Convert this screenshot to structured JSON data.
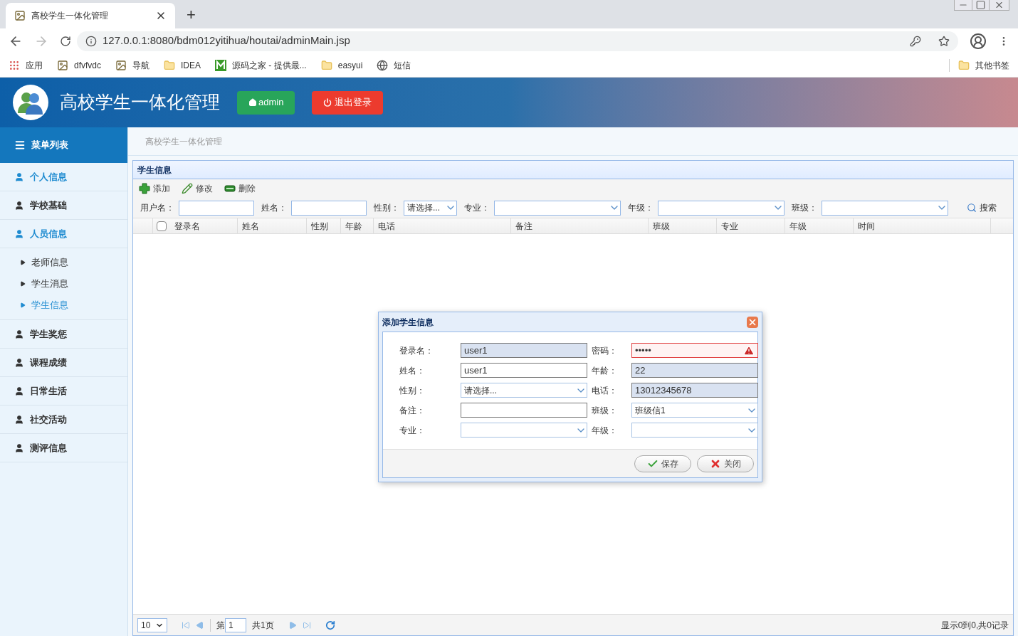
{
  "browser": {
    "tab_title": "高校学生一体化管理",
    "new_tab": "+",
    "url": "127.0.0.1:8080/bdm012yitihua/houtai/adminMain.jsp",
    "bookmarks": [
      {
        "label": "应用",
        "kind": "apps"
      },
      {
        "label": "dfvfvdc",
        "kind": "image"
      },
      {
        "label": "导航",
        "kind": "image"
      },
      {
        "label": "IDEA",
        "kind": "folder"
      },
      {
        "label": "源码之家 - 提供最...",
        "kind": "m"
      },
      {
        "label": "easyui",
        "kind": "folder"
      },
      {
        "label": "短信",
        "kind": "globe"
      }
    ],
    "other_bookmarks": "其他书签"
  },
  "header": {
    "title": "高校学生一体化管理",
    "user_button": "admin",
    "logout_button": "退出登录"
  },
  "sidebar": {
    "title": "菜单列表",
    "items": [
      {
        "label": "个人信息",
        "selected": true
      },
      {
        "label": "学校基础",
        "selected": false
      },
      {
        "label": "人员信息",
        "selected": true,
        "children": [
          {
            "label": "老师信息",
            "selected": false
          },
          {
            "label": "学生消息",
            "selected": false
          },
          {
            "label": "学生信息",
            "selected": true
          }
        ]
      },
      {
        "label": "学生奖惩",
        "selected": false
      },
      {
        "label": "课程成绩",
        "selected": false
      },
      {
        "label": "日常生活",
        "selected": false
      },
      {
        "label": "社交活动",
        "selected": false
      },
      {
        "label": "测评信息",
        "selected": false
      }
    ]
  },
  "breadcrumb": "高校学生一体化管理",
  "panel": {
    "title": "学生信息",
    "toolbar": [
      {
        "label": "添加",
        "kind": "add"
      },
      {
        "label": "修改",
        "kind": "edit"
      },
      {
        "label": "删除",
        "kind": "delete"
      }
    ],
    "filters": [
      {
        "label": "用户名：",
        "kind": "text"
      },
      {
        "label": "姓名：",
        "kind": "text"
      },
      {
        "label": "性别：",
        "kind": "select",
        "value": "请选择..."
      },
      {
        "label": "专业：",
        "kind": "select"
      },
      {
        "label": "年级：",
        "kind": "select"
      },
      {
        "label": "班级：",
        "kind": "select"
      }
    ],
    "search_button": "搜索",
    "select_all_checked": false,
    "columns": [
      "登录名",
      "姓名",
      "性别",
      "年龄",
      "电话",
      "备注",
      "班级",
      "专业",
      "年级",
      "时间"
    ],
    "pager": {
      "page_size": "10",
      "page_prefix": "第",
      "page": "1",
      "page_total": "共1页",
      "summary": "显示0到0,共0记录"
    }
  },
  "dialog": {
    "title": "添加学生信息",
    "fields": [
      {
        "label": "登录名：",
        "kind": "text",
        "value": "user1",
        "autofilled": true,
        "invalid": false
      },
      {
        "label": "密码：",
        "kind": "text",
        "value": "•••••",
        "autofilled": false,
        "invalid": true
      },
      {
        "label": "姓名：",
        "kind": "text",
        "value": "user1",
        "autofilled": false,
        "invalid": false
      },
      {
        "label": "年龄：",
        "kind": "text",
        "value": "22",
        "autofilled": true,
        "invalid": false
      },
      {
        "label": "性别：",
        "kind": "select",
        "value": "请选择...",
        "autofilled": false,
        "invalid": false
      },
      {
        "label": "电话：",
        "kind": "text",
        "value": "13012345678",
        "autofilled": true,
        "invalid": false
      },
      {
        "label": "备注：",
        "kind": "text",
        "autofilled": false,
        "invalid": false
      },
      {
        "label": "班级：",
        "kind": "select",
        "value": "班级信1",
        "autofilled": false,
        "invalid": false
      },
      {
        "label": "专业：",
        "kind": "select",
        "autofilled": false,
        "invalid": false
      },
      {
        "label": "年级：",
        "kind": "select",
        "autofilled": false,
        "invalid": false
      }
    ],
    "buttons": [
      {
        "label": "保存",
        "kind": "save"
      },
      {
        "label": "关闭",
        "kind": "close"
      }
    ]
  }
}
